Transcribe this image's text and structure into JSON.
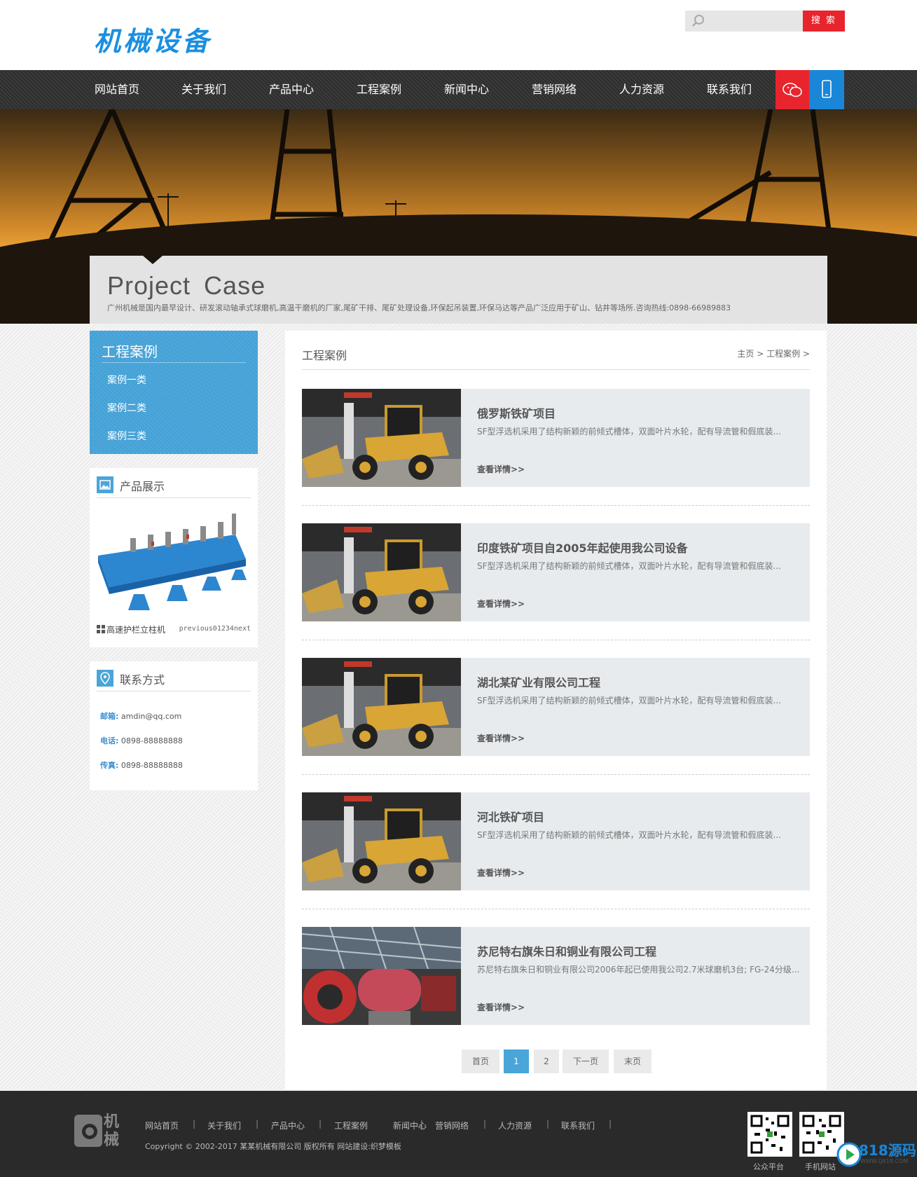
{
  "header": {
    "logo_text": "机械设备",
    "search_placeholder": "",
    "search_button": "搜 索"
  },
  "nav": {
    "items": [
      "网站首页",
      "关于我们",
      "产品中心",
      "工程案例",
      "新闻中心",
      "营销网络",
      "人力资源",
      "联系我们"
    ],
    "wechat_icon": "wechat-icon",
    "mobile_icon": "mobile-icon"
  },
  "banner": {
    "title": "Project  Case",
    "description": "广州机械是国内最早设计、研发滚动轴承式球磨机,高温干磨机的厂家,尾矿干排、尾矿处理设备,环保起吊装置,环保马达等产品广泛应用于矿山、钻井等场所.咨询热线:0898-66989883"
  },
  "sidebar": {
    "category_title": "工程案例",
    "categories": [
      "案例一类",
      "案例二类",
      "案例三类"
    ],
    "products": {
      "title": "产品展示",
      "caption": "高速护栏立柱机",
      "pager": "previous01234next"
    },
    "contact": {
      "title": "联系方式",
      "rows": [
        {
          "label": "邮箱:",
          "value": "amdin@qq.com"
        },
        {
          "label": "电话:",
          "value": "0898-88888888"
        },
        {
          "label": "传真:",
          "value": "0898-88888888"
        }
      ]
    }
  },
  "main": {
    "title": "工程案例",
    "breadcrumb": {
      "home": "主页",
      "sep": ">",
      "current": "工程案例"
    },
    "cases": [
      {
        "title": "俄罗斯铁矿项目",
        "desc": "SF型浮选机采用了结构新颖的前倾式槽体，双面叶片水轮，配有导流管和假底装...",
        "more": "查看详情>>",
        "image": "loader"
      },
      {
        "title": "印度铁矿项目自2005年起使用我公司设备",
        "desc": "SF型浮选机采用了结构新颖的前倾式槽体，双面叶片水轮，配有导流管和假底装...",
        "more": "查看详情>>",
        "image": "loader"
      },
      {
        "title": "湖北某矿业有限公司工程",
        "desc": "SF型浮选机采用了结构新颖的前倾式槽体，双面叶片水轮，配有导流管和假底装...",
        "more": "查看详情>>",
        "image": "loader"
      },
      {
        "title": "河北铁矿项目",
        "desc": "SF型浮选机采用了结构新颖的前倾式槽体，双面叶片水轮，配有导流管和假底装...",
        "more": "查看详情>>",
        "image": "loader"
      },
      {
        "title": "苏尼特右旗朱日和铜业有限公司工程",
        "desc": "苏尼特右旗朱日和铜业有限公司2006年起已使用我公司2.7米球磨机3台; FG-24分级...",
        "more": "查看详情>>",
        "image": "mill"
      }
    ],
    "pagination": [
      "首页",
      "1",
      "2",
      "下一页",
      "末页"
    ],
    "current_page": "1"
  },
  "footer": {
    "logo_text": "机械",
    "links": [
      "网站首页",
      "关于我们",
      "产品中心",
      "工程案例",
      "新闻中心",
      "营销网络",
      "人力资源",
      "联系我们"
    ],
    "separator": "|",
    "copyright": "Copyright © 2002-2017 某某机械有限公司 版权所有 网站建设:织梦模板",
    "qr_labels": [
      "公众平台",
      "手机网站"
    ],
    "badge_text": "818源码",
    "badge_sub": "WWW.Q818.COM"
  },
  "colors": {
    "brand_blue": "#1a8fe0",
    "accent_red": "#e8242d",
    "side_blue": "#4aa5d9",
    "footer_bg": "#2a2a2a"
  }
}
